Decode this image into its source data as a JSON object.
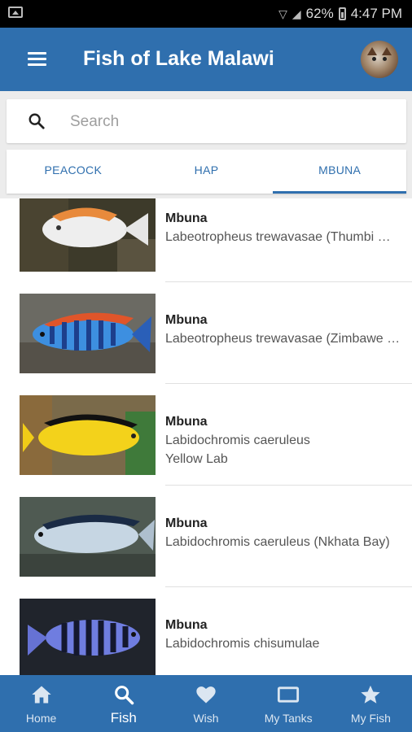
{
  "status_bar": {
    "battery": "62%",
    "time": "4:47 PM"
  },
  "app_bar": {
    "title": "Fish of Lake Malawi"
  },
  "search": {
    "placeholder": "Search",
    "value": ""
  },
  "tabs": [
    {
      "label": "PEACOCK",
      "active": false
    },
    {
      "label": "HAP",
      "active": false
    },
    {
      "label": "MBUNA",
      "active": true
    }
  ],
  "fish_list": [
    {
      "category": "Mbuna",
      "scientific": "Labeotropheus trewavasae (Thumbi West)",
      "common": ""
    },
    {
      "category": "Mbuna",
      "scientific": "Labeotropheus trewavasae (Zimbawe Rock)",
      "common": ""
    },
    {
      "category": "Mbuna",
      "scientific": "Labidochromis caeruleus",
      "common": "Yellow Lab"
    },
    {
      "category": "Mbuna",
      "scientific": "Labidochromis caeruleus (Nkhata Bay)",
      "common": ""
    },
    {
      "category": "Mbuna",
      "scientific": "Labidochromis chisumulae",
      "common": ""
    }
  ],
  "bottom_nav": [
    {
      "label": "Home",
      "icon": "home-icon",
      "active": false
    },
    {
      "label": "Fish",
      "icon": "search-icon",
      "active": true
    },
    {
      "label": "Wish",
      "icon": "heart-icon",
      "active": false
    },
    {
      "label": "My Tanks",
      "icon": "tank-icon",
      "active": false
    },
    {
      "label": "My Fish",
      "icon": "star-icon",
      "active": false
    }
  ],
  "colors": {
    "primary": "#2f6fae",
    "background": "#ececec"
  }
}
